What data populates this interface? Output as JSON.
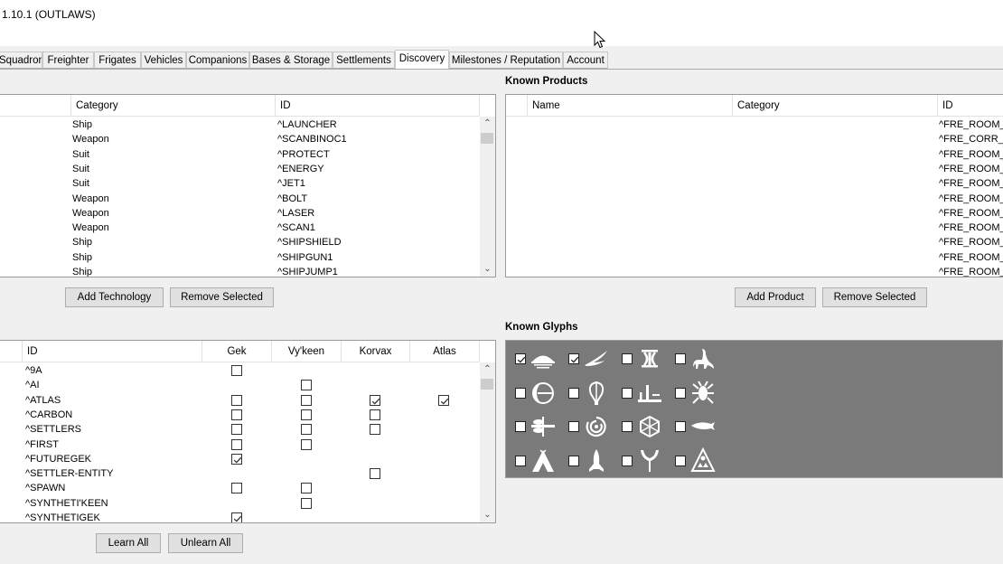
{
  "window": {
    "title": "1.10.1 (OUTLAWS)"
  },
  "tabs": [
    {
      "label": "Squadron"
    },
    {
      "label": "Freighter"
    },
    {
      "label": "Frigates"
    },
    {
      "label": "Vehicles"
    },
    {
      "label": "Companions"
    },
    {
      "label": "Bases & Storage"
    },
    {
      "label": "Settlements"
    },
    {
      "label": "Discovery",
      "active": true
    },
    {
      "label": "Milestones / Reputation"
    },
    {
      "label": "Account"
    }
  ],
  "tech": {
    "headers": {
      "category": "Category",
      "id": "ID"
    },
    "rows": [
      {
        "category": "Ship",
        "id": "^LAUNCHER"
      },
      {
        "category": "Weapon",
        "id": "^SCANBINOC1"
      },
      {
        "category": "Suit",
        "id": "^PROTECT"
      },
      {
        "category": "Suit",
        "id": "^ENERGY"
      },
      {
        "category": "Suit",
        "id": "^JET1"
      },
      {
        "category": "Weapon",
        "id": "^BOLT"
      },
      {
        "category": "Weapon",
        "id": "^LASER"
      },
      {
        "category": "Weapon",
        "id": "^SCAN1"
      },
      {
        "category": "Ship",
        "id": "^SHIPSHIELD"
      },
      {
        "category": "Ship",
        "id": "^SHIPGUN1"
      },
      {
        "category": "Ship",
        "id": "^SHIPJUMP1"
      }
    ],
    "add_label": "Add Technology",
    "remove_label": "Remove Selected"
  },
  "products": {
    "section_label": "Known Products",
    "headers": {
      "name": "Name",
      "category": "Category",
      "id": "ID"
    },
    "rows": [
      {
        "id": "^FRE_ROOM_I"
      },
      {
        "id": "^FRE_CORR_A"
      },
      {
        "id": "^FRE_ROOM_I"
      },
      {
        "id": "^FRE_ROOM_I"
      },
      {
        "id": "^FRE_ROOM_S"
      },
      {
        "id": "^FRE_ROOM_S"
      },
      {
        "id": "^FRE_ROOM_S"
      },
      {
        "id": "^FRE_ROOM_S"
      },
      {
        "id": "^FRE_ROOM_S"
      },
      {
        "id": "^FRE_ROOM_S"
      },
      {
        "id": "^FRE_ROOM_S"
      }
    ],
    "add_label": "Add Product",
    "remove_label": "Remove Selected"
  },
  "words": {
    "headers": {
      "id": "ID",
      "gek": "Gek",
      "vykeen": "Vy'keen",
      "korvax": "Korvax",
      "atlas": "Atlas"
    },
    "rows": [
      {
        "id": "^9A",
        "gek": false,
        "vykeen": null,
        "korvax": null,
        "atlas": null
      },
      {
        "id": "^AI",
        "gek": null,
        "vykeen": false,
        "korvax": null,
        "atlas": null
      },
      {
        "id": "^ATLAS",
        "gek": false,
        "vykeen": false,
        "korvax": true,
        "atlas": true
      },
      {
        "id": "^CARBON",
        "gek": false,
        "vykeen": false,
        "korvax": false,
        "atlas": null
      },
      {
        "id": "^SETTLERS",
        "gek": false,
        "vykeen": false,
        "korvax": false,
        "atlas": null
      },
      {
        "id": "^FIRST",
        "gek": false,
        "vykeen": false,
        "korvax": null,
        "atlas": null
      },
      {
        "id": "^FUTUREGEK",
        "gek": true,
        "vykeen": null,
        "korvax": null,
        "atlas": null
      },
      {
        "id": "^SETTLER-ENTITY",
        "gek": null,
        "vykeen": null,
        "korvax": false,
        "atlas": null
      },
      {
        "id": "^SPAWN",
        "gek": false,
        "vykeen": false,
        "korvax": null,
        "atlas": null
      },
      {
        "id": "^SYNTHETI'KEEN",
        "gek": null,
        "vykeen": false,
        "korvax": null,
        "atlas": null
      },
      {
        "id": "^SYNTHETIGEK",
        "gek": true,
        "vykeen": null,
        "korvax": null,
        "atlas": null
      }
    ],
    "learn_all_label": "Learn All",
    "unlearn_all_label": "Unlearn All"
  },
  "glyphs": {
    "section_label": "Known Glyphs",
    "items": [
      {
        "icon": "sunset-glyph-icon",
        "checked": true
      },
      {
        "icon": "bird-glyph-icon",
        "checked": true
      },
      {
        "icon": "face-glyph-icon",
        "checked": false
      },
      {
        "icon": "diplo-glyph-icon",
        "checked": false
      },
      {
        "icon": "eclipse-glyph-icon",
        "checked": false
      },
      {
        "icon": "balloon-glyph-icon",
        "checked": false
      },
      {
        "icon": "boat-glyph-icon",
        "checked": false
      },
      {
        "icon": "bug-glyph-icon",
        "checked": false
      },
      {
        "icon": "dragonfly-glyph-icon",
        "checked": false
      },
      {
        "icon": "galaxy-glyph-icon",
        "checked": false
      },
      {
        "icon": "voxel-glyph-icon",
        "checked": false
      },
      {
        "icon": "fish-glyph-icon",
        "checked": false
      },
      {
        "icon": "tent-glyph-icon",
        "checked": false
      },
      {
        "icon": "rocket-glyph-icon",
        "checked": false
      },
      {
        "icon": "tree-glyph-icon",
        "checked": false
      },
      {
        "icon": "atlas-glyph-icon",
        "checked": false
      }
    ]
  }
}
